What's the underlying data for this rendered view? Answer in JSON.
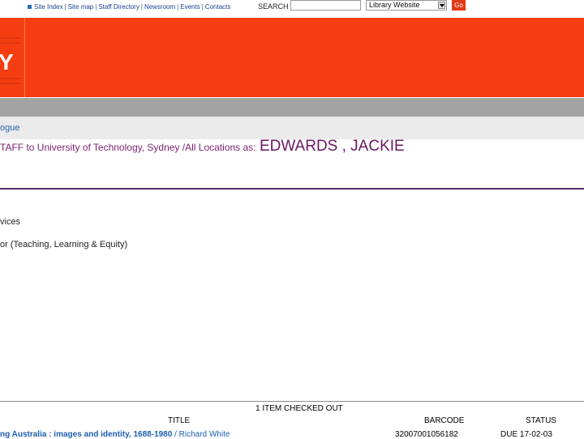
{
  "top_nav": {
    "links": [
      "Site Index",
      "Site map",
      "Staff Directory",
      "Newsroom",
      "Events",
      "Contacts"
    ],
    "search_label": "SEARCH",
    "search_value": "",
    "scope_selected": "Library Website",
    "go_label": "Go"
  },
  "banner": {
    "color": "#f43e12",
    "logo_letter": "Y"
  },
  "breadcrumb": "ogue",
  "account": {
    "logged_in_prefix": "TAFF to University of Technology, Sydney /All Locations as:",
    "user_name": "EDWARDS , JACKIE",
    "line1": "vices",
    "line2": "or (Teaching, Learning & Equity)"
  },
  "checkout_table": {
    "heading": "1 ITEM CHECKED OUT",
    "columns": [
      "TITLE",
      "BARCODE",
      "STATUS"
    ],
    "rows": [
      {
        "title_bold": "ng Australia : images and identity, 1688-1980",
        "title_rest": " / Richard White",
        "barcode": "32007001056182",
        "status": "DUE 17-02-03"
      }
    ]
  }
}
